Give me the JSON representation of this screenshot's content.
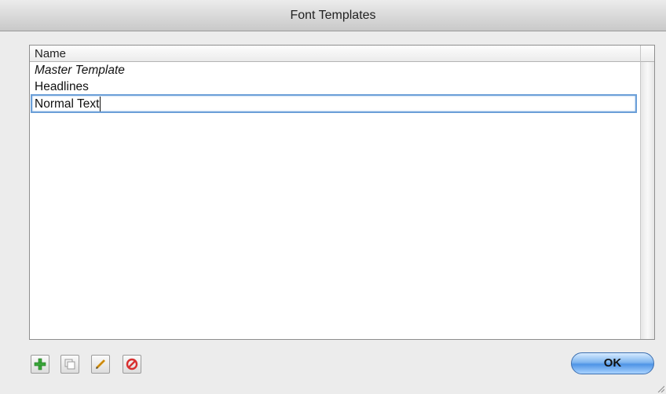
{
  "window": {
    "title": "Font Templates"
  },
  "table": {
    "column_header": "Name",
    "rows": [
      {
        "label": "Master Template",
        "style": "italic"
      },
      {
        "label": "Headlines",
        "style": "normal"
      }
    ],
    "editing_row": {
      "value": "Normal Text"
    }
  },
  "toolbar": {
    "buttons": [
      {
        "name": "add-icon",
        "color": "#3aa63a"
      },
      {
        "name": "duplicate-icon",
        "color": "#9a9a9a"
      },
      {
        "name": "edit-icon",
        "color": "#e0a020"
      },
      {
        "name": "delete-icon",
        "color": "#d83030"
      }
    ]
  },
  "ok_button": {
    "label": "OK"
  },
  "colors": {
    "accent": "#4f94e6",
    "selection_border": "#6b9fd8"
  }
}
